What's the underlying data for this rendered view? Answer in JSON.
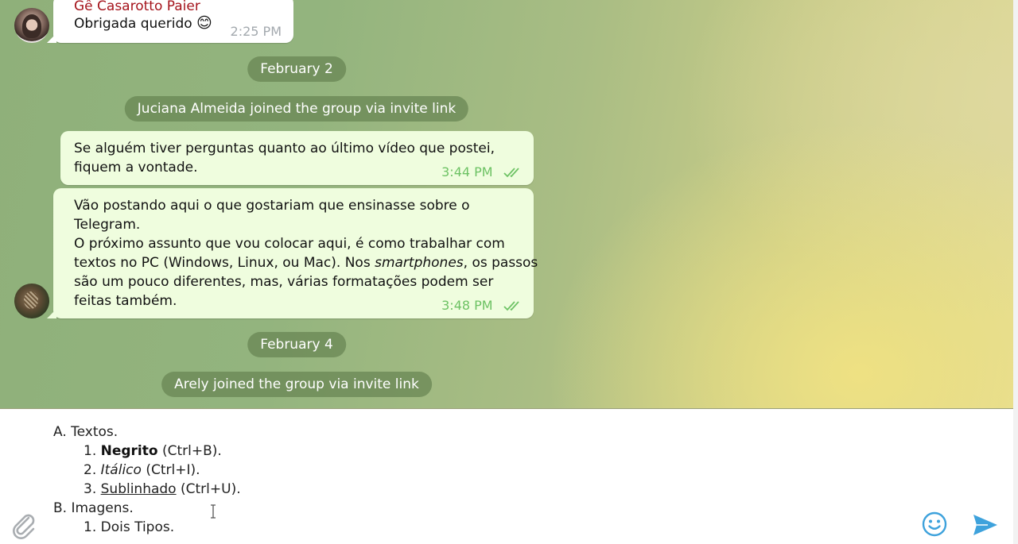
{
  "messages": [
    {
      "type": "incoming",
      "sender": "Gê Casarotto Paier",
      "text": "Obrigada querido",
      "emoji": "😊",
      "time": "2:25 PM",
      "avatar": "woman-portrait"
    },
    {
      "type": "date",
      "text": "February 2"
    },
    {
      "type": "service",
      "text": "Juciana Almeida joined the group via invite link"
    },
    {
      "type": "outgoing",
      "lines": [
        "Se alguém tiver perguntas quanto ao último vídeo que postei,",
        "fiquem a vontade."
      ],
      "time": "3:44 PM",
      "status": "read"
    },
    {
      "type": "outgoing",
      "lines": [
        "Vão postando aqui o que gostariam que ensinasse sobre o",
        "Telegram.",
        "O próximo assunto que vou colocar aqui, é como trabalhar com",
        "textos no PC (Windows, Linux, ou Mac). Nos ",
        "smartphones",
        ", os passos",
        "são um pouco diferentes, mas, várias formatações podem ser",
        "feitas também."
      ],
      "time": "3:48 PM",
      "status": "read",
      "avatar": "eagle"
    },
    {
      "type": "date",
      "text": "February 4"
    },
    {
      "type": "service",
      "text": "Arely joined the group via invite link"
    }
  ],
  "composer": {
    "lines": [
      {
        "prefix": "A. ",
        "text": "Textos."
      },
      {
        "prefix": "1. ",
        "styled": "Negrito",
        "style": "bold",
        "rest": " (Ctrl+B)."
      },
      {
        "prefix": "2. ",
        "styled": "Itálico",
        "style": "italic",
        "rest": " (Ctrl+I)."
      },
      {
        "prefix": "3. ",
        "styled": "Sublinhado",
        "style": "underline",
        "rest": " (Ctrl+U)."
      },
      {
        "prefix": "B. ",
        "text": "Imagens."
      },
      {
        "prefix": "1. ",
        "text": "Dois Tipos."
      }
    ],
    "icons": {
      "attach": "paperclip-icon",
      "emoji": "smiley-icon",
      "send": "send-icon"
    }
  },
  "colors": {
    "sender_name": "#a5141c",
    "outgoing_bubble": "#effdde",
    "outgoing_time": "#6dc264",
    "accent": "#3ea2dc"
  }
}
